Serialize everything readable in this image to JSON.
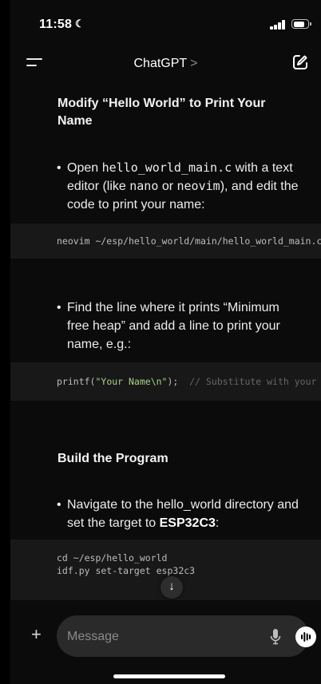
{
  "status_bar": {
    "time": "11:58",
    "focus_icon": "moon-icon"
  },
  "nav": {
    "title": "ChatGPT",
    "title_chevron": ">"
  },
  "content": {
    "heading1": "Modify “Hello World” to Print Your Name",
    "bullet1": {
      "prefix": "Open ",
      "code1": "hello_world_main.c",
      "mid1": " with a text editor (like ",
      "code2": "nano",
      "mid2": " or ",
      "code3": "neovim",
      "suffix": "), and edit the code to print your name:"
    },
    "code1": "neovim ~/esp/hello_world/main/hello_world_main.c",
    "bullet2": "Find the line where it prints “Minimum free heap” and add a line to print your name, e.g.:",
    "code2": {
      "fn": "printf(",
      "str": "\"Your Name\\n\"",
      "end": ");",
      "comment": "// Substitute with your name"
    },
    "heading2": "Build the Program",
    "bullet3": {
      "prefix": "Navigate to the hello_world directory and set the target to ",
      "bold": "ESP32C3",
      "suffix": ":"
    },
    "code3": [
      "cd ~/esp/hello_world",
      "idf.py set-target esp32c3"
    ]
  },
  "composer": {
    "placeholder": "Message"
  }
}
